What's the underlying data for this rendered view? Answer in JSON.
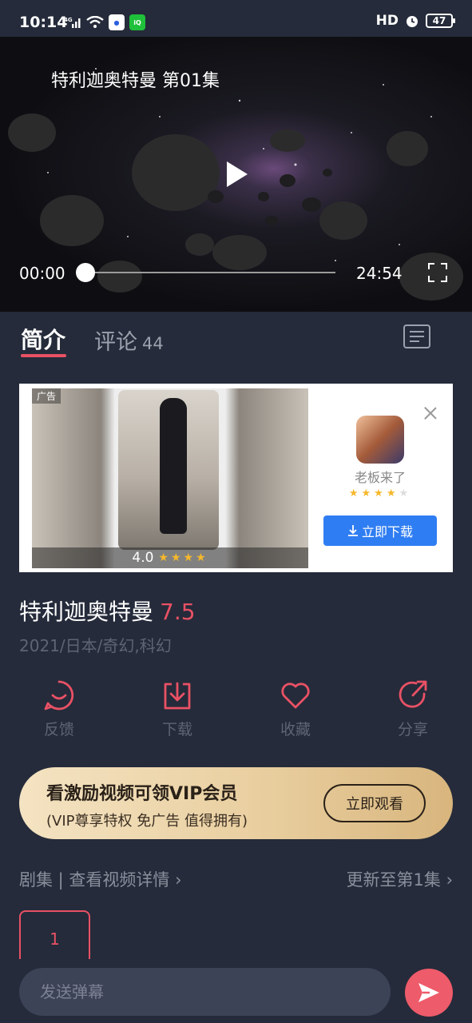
{
  "status_bar": {
    "time": "10:14",
    "network_label": "4G",
    "apps": [
      "baidu-app-badge",
      "iqiyi-app-badge"
    ],
    "hd_label": "HD",
    "battery": "47"
  },
  "player": {
    "title": "特利迦奥特曼 第01集",
    "current_time": "00:00",
    "total_time": "24:54",
    "progress": 0
  },
  "tabs": {
    "intro": "简介",
    "comments": "评论",
    "comments_count": "44"
  },
  "ad": {
    "tag": "广告",
    "rating": "4.0",
    "app_name": "老板来了",
    "download_label": "立即下载",
    "app_stars": 4,
    "media_stars": 4
  },
  "show": {
    "title": "特利迦奥特曼",
    "score": "7.5",
    "meta": "2021/日本/奇幻,科幻"
  },
  "actions": [
    {
      "label": "反馈",
      "icon": "feedback-icon"
    },
    {
      "label": "下载",
      "icon": "download-icon"
    },
    {
      "label": "收藏",
      "icon": "heart-icon"
    },
    {
      "label": "分享",
      "icon": "share-icon"
    }
  ],
  "vip": {
    "title": "看激励视频可领VIP会员",
    "subtitle": "(VIP尊享特权 免广告 值得拥有)",
    "button": "立即观看"
  },
  "episodes": {
    "left_label": "剧集 | 查看视频详情 ›",
    "right_label": "更新至第1集 ›",
    "items": [
      "1"
    ]
  },
  "danmaku": {
    "placeholder": "发送弹幕"
  },
  "colors": {
    "background": "#252b3a",
    "accent": "#e95165",
    "muted": "#5e6474",
    "ad_button": "#2f7df2"
  }
}
